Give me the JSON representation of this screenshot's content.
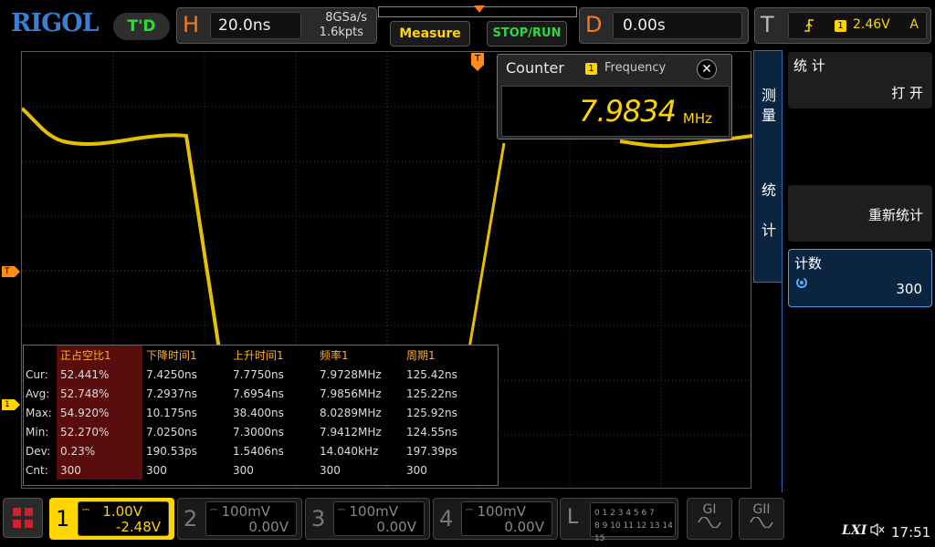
{
  "top": {
    "brand": "RIGOL",
    "run_mode": "T'D",
    "horizontal": {
      "label": "H",
      "timebase": "20.0ns",
      "sample_rate": "8GSa/s",
      "memory_depth": "1.6kpts"
    },
    "measure_label": "Measure",
    "stop_run_label": "STOP/RUN",
    "delay": {
      "label": "D",
      "value": "0.00s"
    },
    "trigger": {
      "label": "T",
      "edge_icon": "rising-edge-icon",
      "source": "1",
      "level": "2.46V",
      "mode": "A"
    }
  },
  "waveform": {
    "trigger_marker": "T",
    "channel_marker": "1",
    "trigger_position_marker": "T",
    "color": "#ffd500"
  },
  "counter": {
    "title": "Counter",
    "source": "1",
    "type": "Frequency",
    "close_label": "✕",
    "value": "7.9834",
    "unit": "MHz"
  },
  "stats": {
    "headers": [
      "",
      "正占空比1",
      "下降时间1",
      "上升时间1",
      "频率1",
      "周期1"
    ],
    "rows": [
      [
        "Cur:",
        "52.441%",
        "7.4250ns",
        "7.7750ns",
        "7.9728MHz",
        "125.42ns"
      ],
      [
        "Avg:",
        "52.748%",
        "7.2937ns",
        "7.6954ns",
        "7.9856MHz",
        "125.22ns"
      ],
      [
        "Max:",
        "54.920%",
        "10.175ns",
        "38.400ns",
        "8.0289MHz",
        "125.92ns"
      ],
      [
        "Min:",
        "52.270%",
        "7.0250ns",
        "7.3000ns",
        "7.9412MHz",
        "124.55ns"
      ],
      [
        "Dev:",
        "0.23%",
        "190.53ps",
        "1.5406ns",
        "14.040kHz",
        "197.39ps"
      ],
      [
        "Cnt:",
        "300",
        "300",
        "300",
        "300",
        "300"
      ]
    ]
  },
  "menu": {
    "tab_upper": [
      "测",
      "量"
    ],
    "tab_lower": [
      "统",
      "计"
    ],
    "items": [
      {
        "label": "统 计",
        "value": "打 开"
      },
      {
        "label": "",
        "value": "重新统计"
      },
      {
        "label": "计数",
        "value": "300",
        "icon": "rotary-knob-icon"
      }
    ]
  },
  "bottom": {
    "channels": [
      {
        "num": "1",
        "coupling": "DC",
        "scale": "1.00V",
        "offset": "-2.48V",
        "active": true
      },
      {
        "num": "2",
        "coupling": "DC",
        "scale": "100mV",
        "offset": "0.00V",
        "active": false
      },
      {
        "num": "3",
        "coupling": "DC",
        "scale": "100mV",
        "offset": "0.00V",
        "active": false
      },
      {
        "num": "4",
        "coupling": "DC",
        "scale": "100mV",
        "offset": "0.00V",
        "active": false
      }
    ],
    "logic": {
      "label": "L",
      "row1": "0 1 2 3  4 5 6 7",
      "row2": "8 9 10 11  12 13 14 15"
    },
    "gen1": "GI",
    "gen2": "GII",
    "lxi": "LXI",
    "time": "17:51"
  }
}
